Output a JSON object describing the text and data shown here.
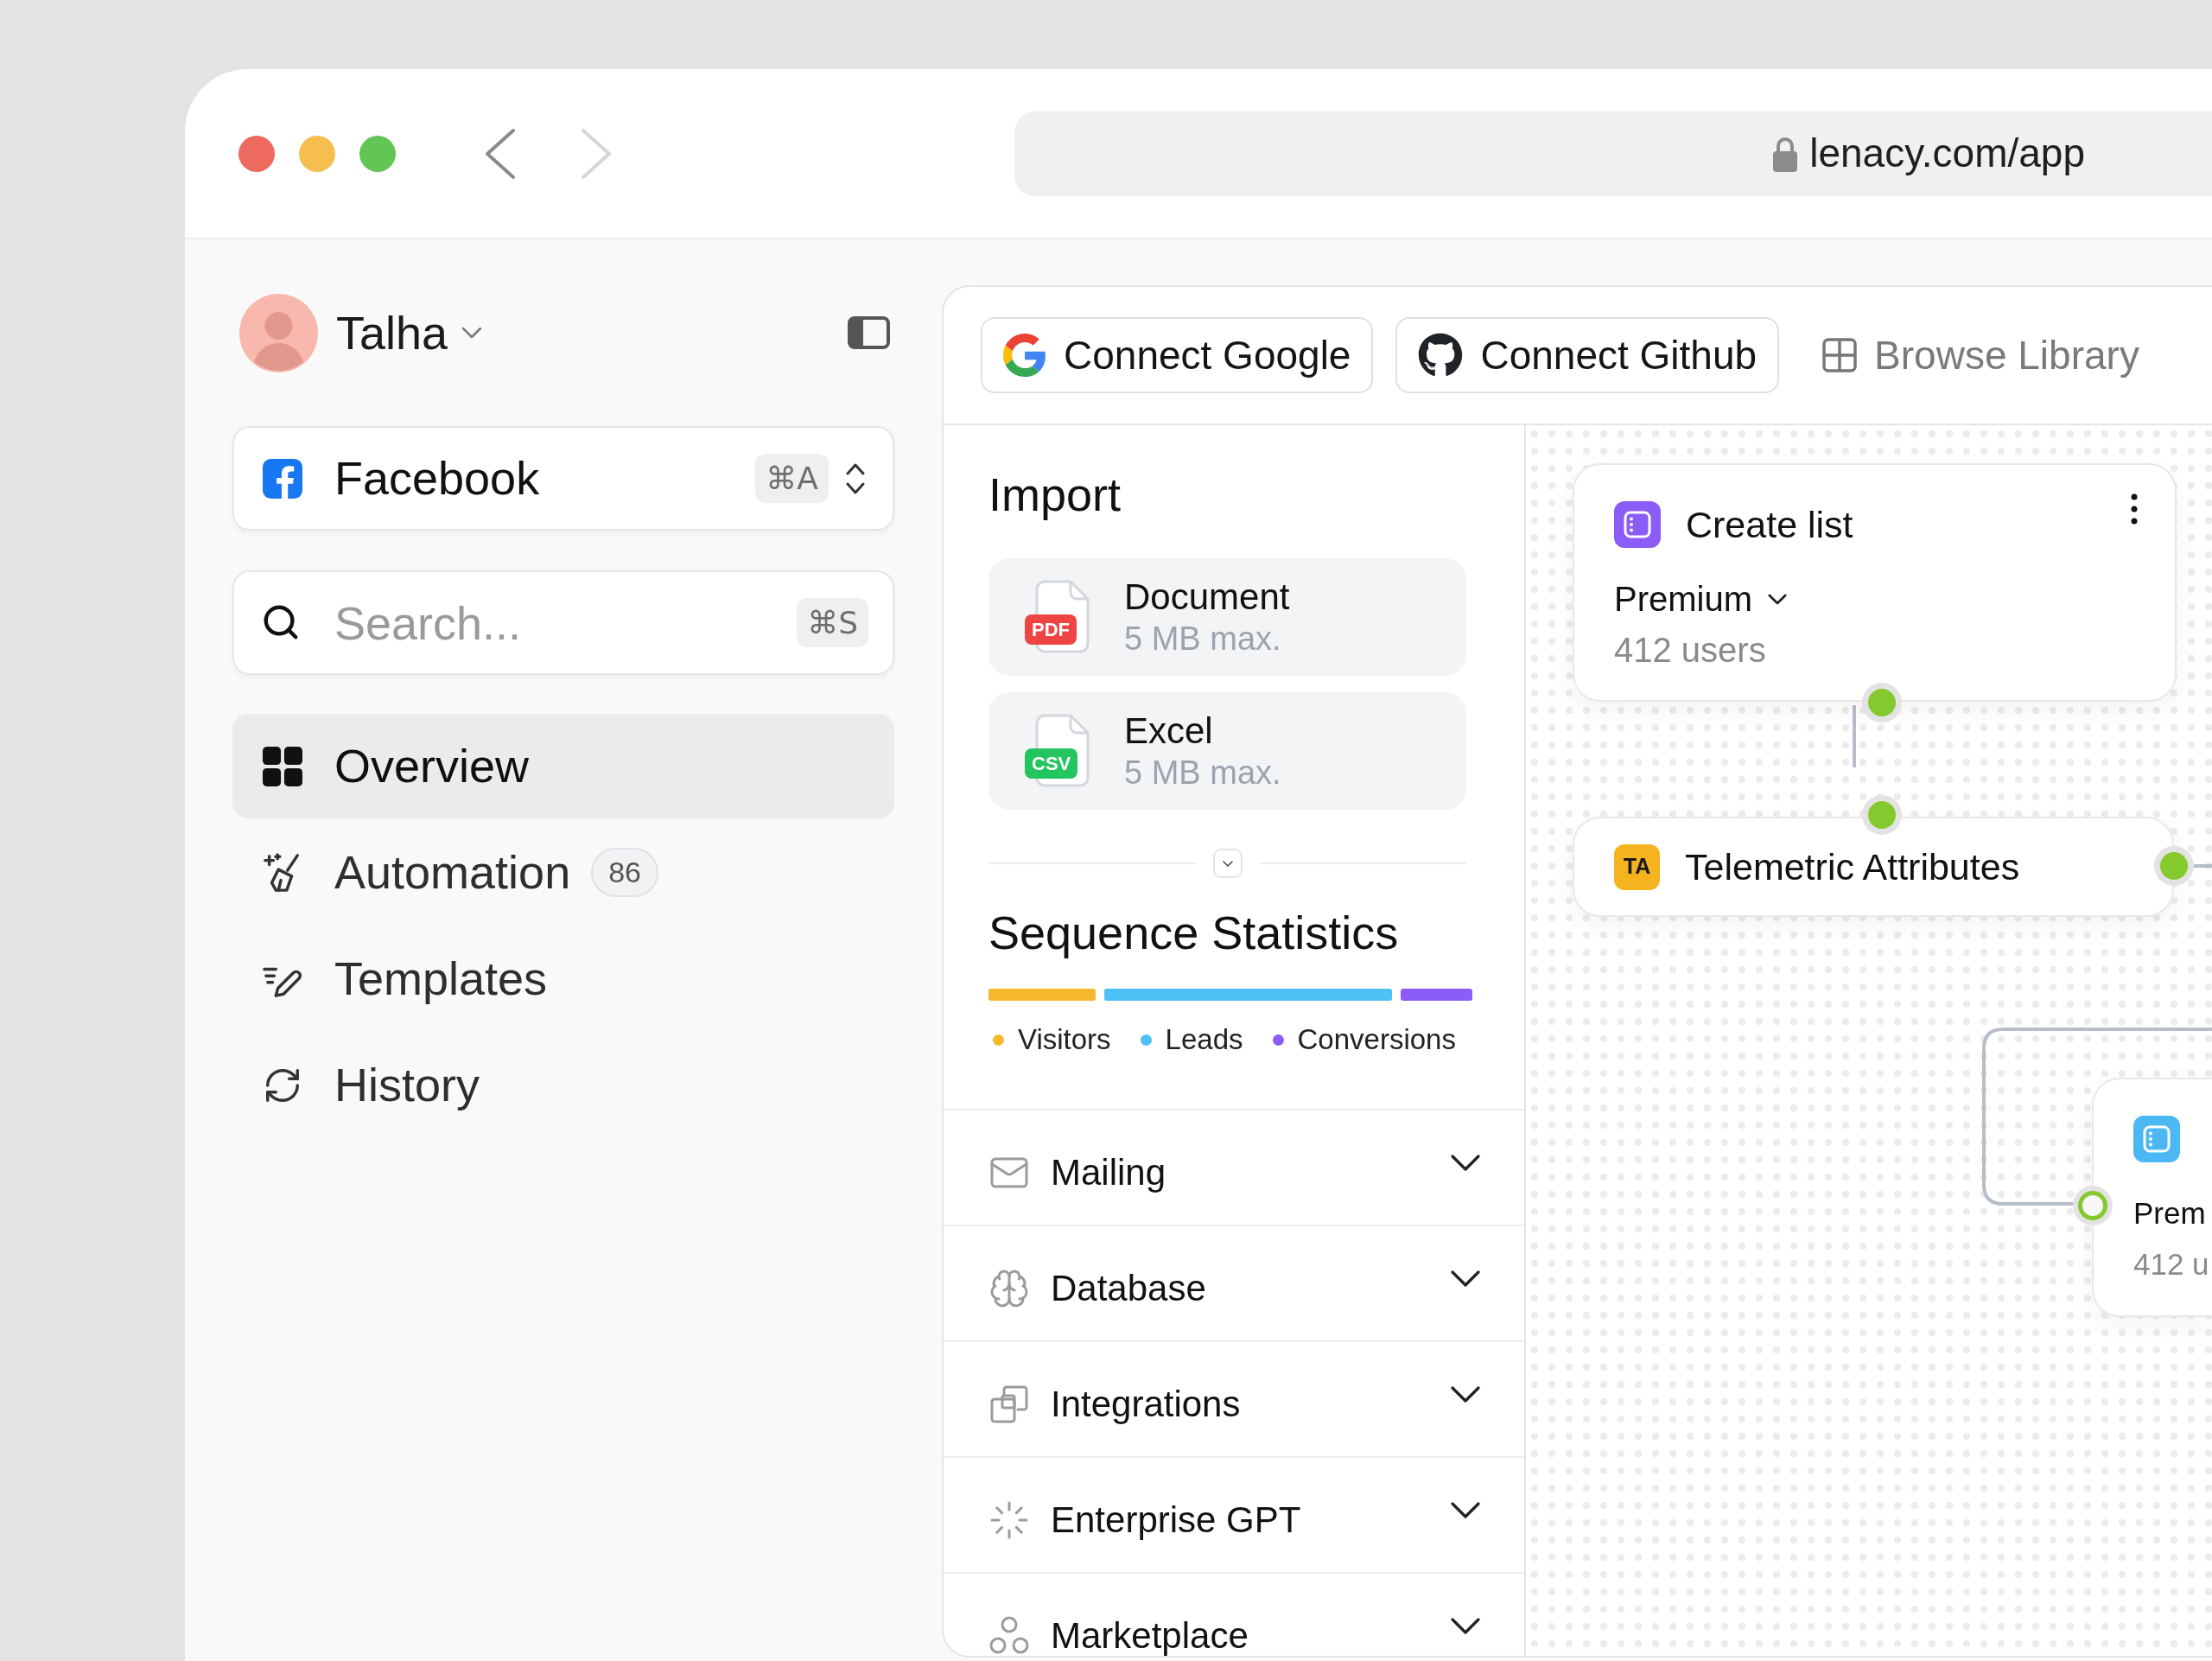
{
  "browser": {
    "nav_buttons": [
      {
        "kind": "back",
        "disabled": false
      },
      {
        "kind": "forward",
        "disabled": true
      }
    ],
    "url": "lenacy.com/app"
  },
  "sidebar": {
    "user": {
      "name": "Talha"
    },
    "workspace": {
      "name": "Facebook",
      "shortcut": "⌘A"
    },
    "search": {
      "placeholder": "Search...",
      "shortcut": "⌘S"
    },
    "nav": [
      {
        "label": "Overview",
        "selected": true
      },
      {
        "label": "Automation",
        "badge": "86",
        "selected": false
      },
      {
        "label": "Templates",
        "selected": false
      },
      {
        "label": "History",
        "selected": false
      }
    ]
  },
  "toolbar": [
    {
      "kind": "outlined",
      "label": "Connect Google"
    },
    {
      "kind": "outlined",
      "label": "Connect Github"
    },
    {
      "kind": "plain",
      "label": "Browse Library"
    }
  ],
  "import": {
    "title": "Import",
    "files": [
      {
        "name": "Document",
        "type": "PDF",
        "limit": "5 MB max.",
        "color": "#ef4444"
      },
      {
        "name": "Excel",
        "type": "CSV",
        "limit": "5 MB max.",
        "color": "#22c55e"
      }
    ]
  },
  "statistics": {
    "title": "Sequence Statistics",
    "segments": [
      {
        "label": "Visitors",
        "color": "#f5b82e"
      },
      {
        "label": "Leads",
        "color": "#4dc0f5"
      },
      {
        "label": "Conversions",
        "color": "#8b5cf6"
      }
    ]
  },
  "sections": [
    {
      "label": "Mailing",
      "expanded": false
    },
    {
      "label": "Database",
      "expanded": false
    },
    {
      "label": "Integrations",
      "expanded": false
    },
    {
      "label": "Enterprise GPT",
      "expanded": false
    },
    {
      "label": "Marketplace",
      "expanded": false
    }
  ],
  "canvas": {
    "nodes": [
      {
        "kind": "list",
        "color": "#8b5cf6",
        "title": "Create list",
        "menu": true,
        "option": "Premium",
        "count": "412 users",
        "ports": [
          {
            "kind": "bottom",
            "filled": true
          }
        ]
      },
      {
        "kind": "attribute",
        "color": "#f5b41f",
        "badge": "TA",
        "title": "Telemetric Attributes",
        "ports": [
          {
            "kind": "top",
            "filled": true
          },
          {
            "kind": "right",
            "filled": true
          }
        ]
      },
      {
        "kind": "list",
        "color": "#4bb8f4",
        "option": "Prem",
        "count": "412 u",
        "ports": [
          {
            "kind": "left",
            "filled": false
          }
        ]
      }
    ]
  }
}
